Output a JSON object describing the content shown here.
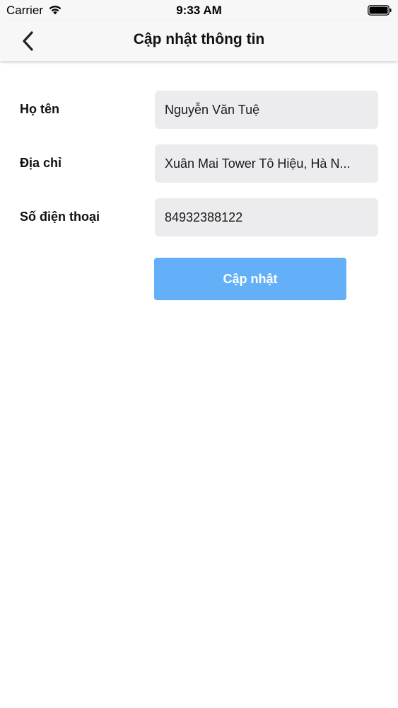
{
  "status_bar": {
    "carrier": "Carrier",
    "time": "9:33 AM",
    "icons": [
      "wifi-icon",
      "battery-icon"
    ]
  },
  "nav": {
    "back_icon": "chevron-left-icon",
    "title": "Cập nhật thông tin"
  },
  "form": {
    "fields": [
      {
        "label": "Họ tên",
        "value": "Nguyễn Văn Tuệ"
      },
      {
        "label": "Địa chỉ",
        "value": "Xuân Mai Tower Tô Hiệu, Hà N..."
      },
      {
        "label": "Số điện thoại",
        "value": "84932388122"
      }
    ],
    "submit_label": "Cập nhật"
  },
  "colors": {
    "button_bg": "#63b0f8",
    "input_bg": "#ececee",
    "nav_bg": "#f7f7f7"
  }
}
